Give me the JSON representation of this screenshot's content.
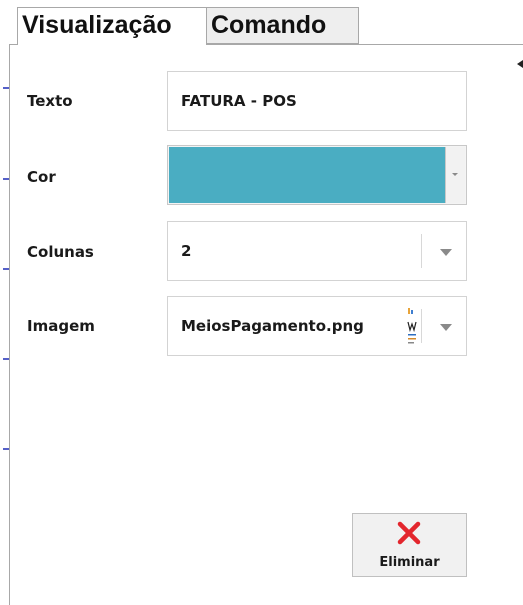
{
  "tabs": [
    {
      "label": "Visualização",
      "active": true
    },
    {
      "label": "Comando",
      "active": false
    }
  ],
  "form": {
    "texto": {
      "label": "Texto",
      "value": "FATURA - POS"
    },
    "cor": {
      "label": "Cor",
      "color": "#4aadc2"
    },
    "colunas": {
      "label": "Colunas",
      "value": "2"
    },
    "imagem": {
      "label": "Imagem",
      "value": "MeiosPagamento.png"
    }
  },
  "actions": {
    "delete_label": "Eliminar"
  },
  "colors": {
    "delete_icon": "#e3262d",
    "tick_marks": "#5560c8",
    "swatch": "#4aadc2"
  },
  "icons": {
    "delete": "red-x-icon",
    "dropdown": "chevron-down-icon",
    "image_preview": "image-thumbnail-icon"
  }
}
